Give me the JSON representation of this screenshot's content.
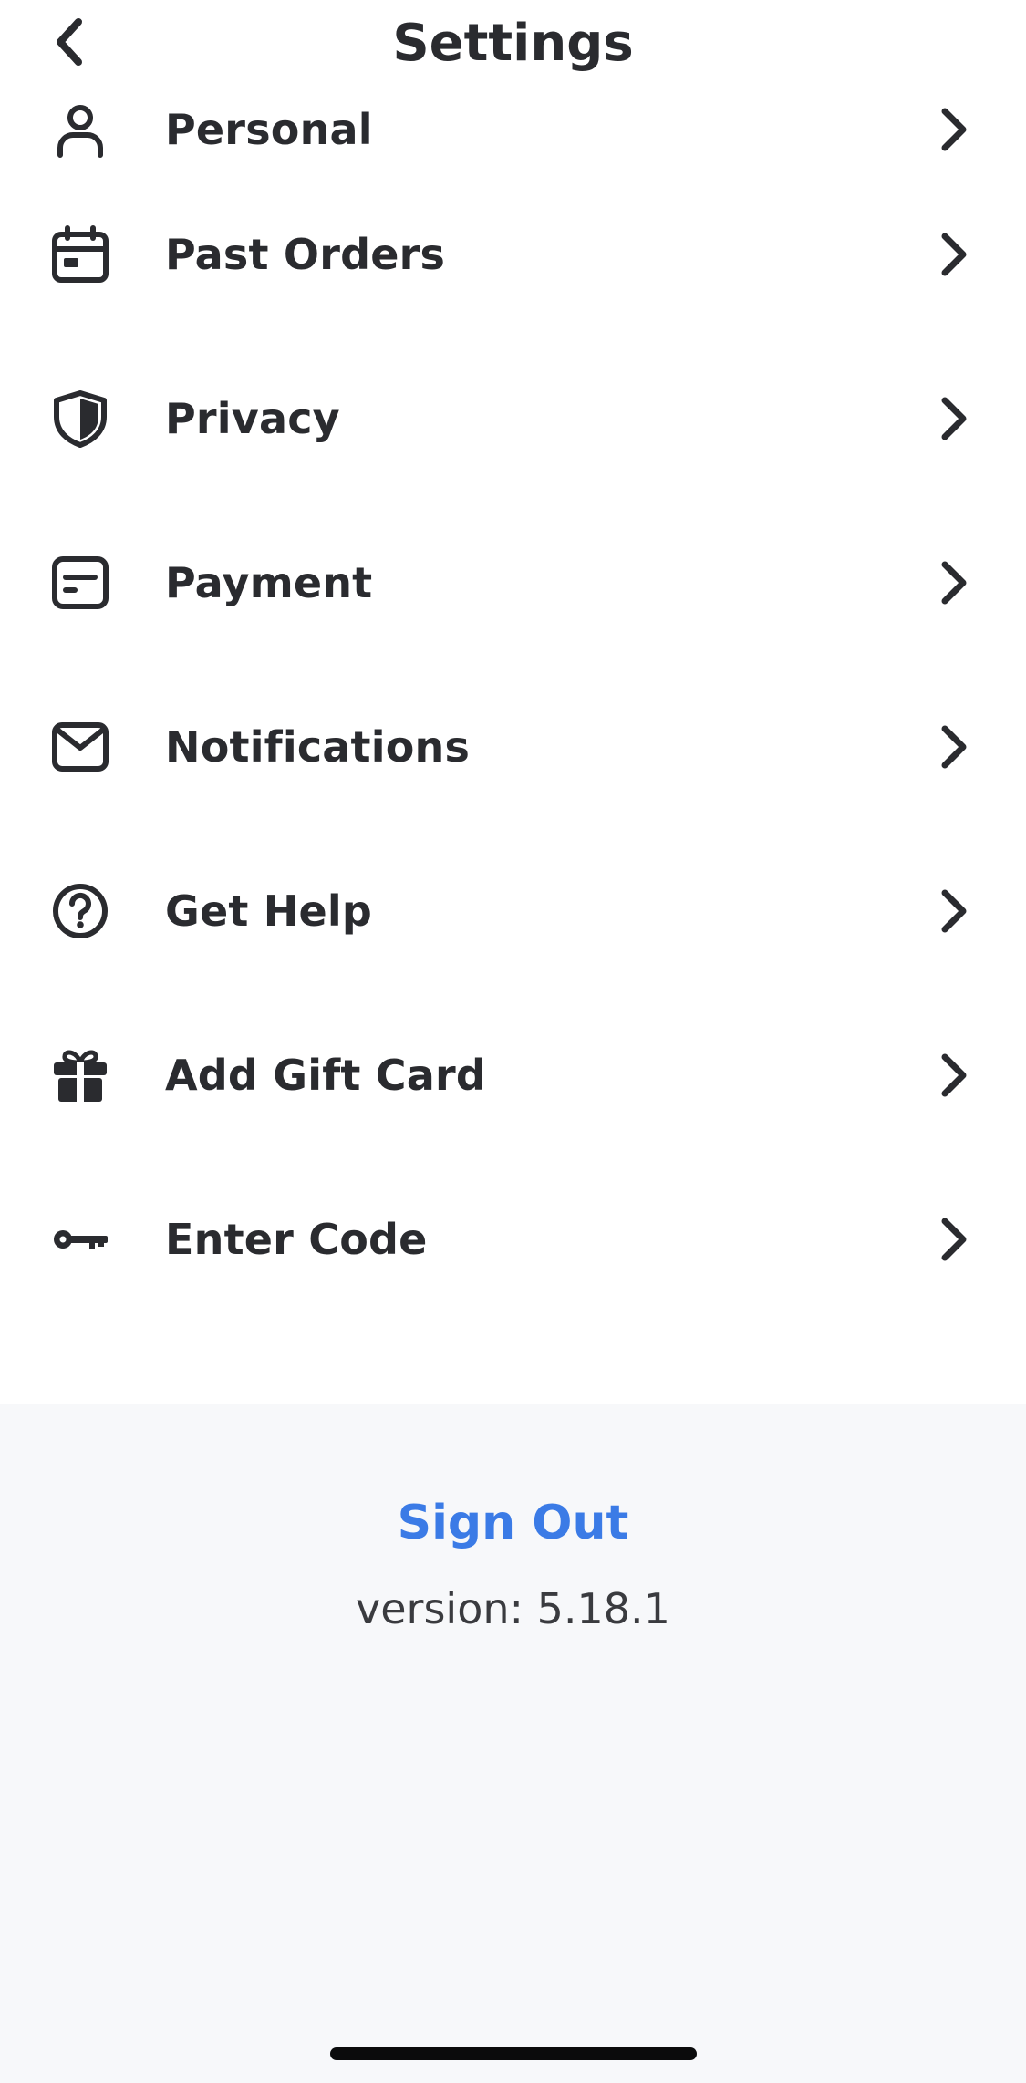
{
  "header": {
    "title": "Settings",
    "back_icon": "chevron-left-icon"
  },
  "menu": {
    "items": [
      {
        "label": "Personal",
        "icon": "person-icon"
      },
      {
        "label": "Past Orders",
        "icon": "calendar-icon"
      },
      {
        "label": "Privacy",
        "icon": "shield-icon"
      },
      {
        "label": "Payment",
        "icon": "card-icon"
      },
      {
        "label": "Notifications",
        "icon": "mail-icon"
      },
      {
        "label": "Get Help",
        "icon": "help-circle-icon"
      },
      {
        "label": "Add Gift Card",
        "icon": "gift-icon"
      },
      {
        "label": "Enter Code",
        "icon": "key-icon"
      }
    ]
  },
  "footer": {
    "sign_out_label": "Sign Out",
    "version_text": "version: 5.18.1"
  },
  "colors": {
    "text": "#2a2b2f",
    "accent": "#3b7be6",
    "footer_bg": "#f7f8fa",
    "background": "#ffffff"
  }
}
